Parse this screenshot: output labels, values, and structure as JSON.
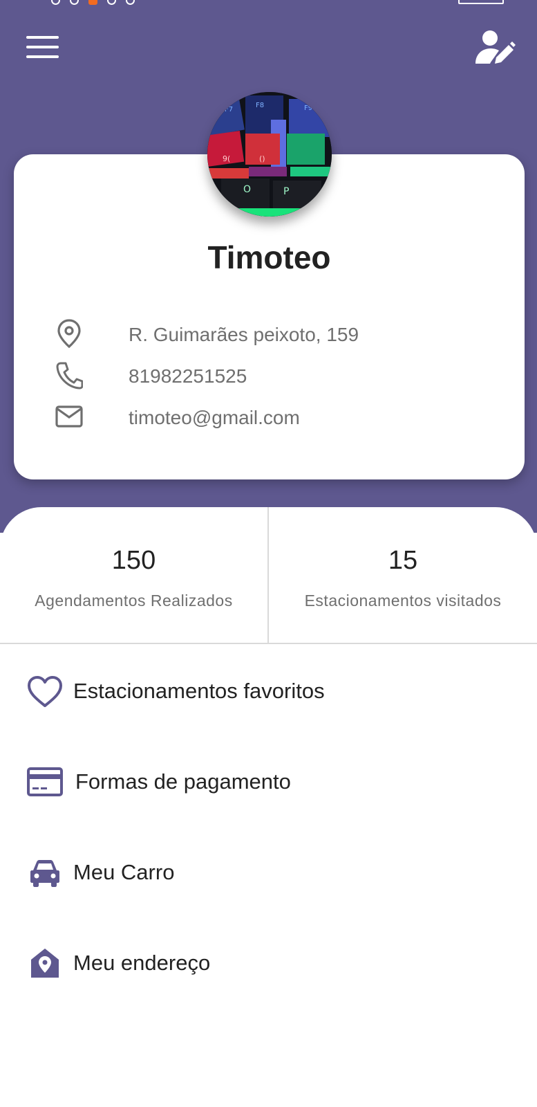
{
  "header": {
    "menu_label": "Menu",
    "edit_label": "Editar perfil"
  },
  "profile": {
    "name": "Timoteo",
    "address": "R. Guimarães peixoto, 159",
    "phone": "81982251525",
    "email": "timoteo@gmail.com"
  },
  "stats": [
    {
      "value": "150",
      "label": "Agendamentos Realizados"
    },
    {
      "value": "15",
      "label": "Estacionamentos visitados"
    }
  ],
  "menu": [
    {
      "label": "Estacionamentos favoritos",
      "icon": "heart-icon"
    },
    {
      "label": "Formas de pagamento",
      "icon": "credit-card-icon"
    },
    {
      "label": "Meu Carro",
      "icon": "car-icon"
    },
    {
      "label": "Meu endereço",
      "icon": "home-pin-icon"
    }
  ],
  "colors": {
    "accent": "#5e588f",
    "text": "#222222",
    "muted": "#6f6f6f",
    "divider": "#d9d9d9"
  }
}
